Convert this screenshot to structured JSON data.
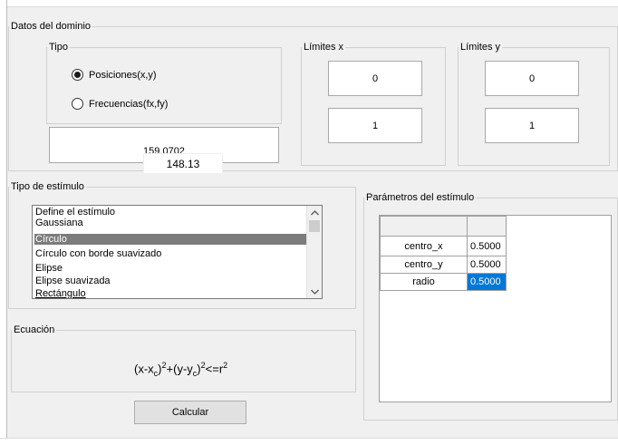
{
  "domain_panel": {
    "title": "Datos del dominio",
    "tipo": {
      "title": "Tipo",
      "options": [
        "Posiciones(x,y)",
        "Frecuencias(fx,fy)"
      ],
      "selected_index": 0
    },
    "value_display": "159.0702",
    "limits_x": {
      "title": "Límites x",
      "min": "0",
      "max": "1"
    },
    "limits_y": {
      "title": "Límites y",
      "min": "0",
      "max": "1"
    }
  },
  "tooltip": "148.13",
  "stimulus_type": {
    "title": "Tipo de estímulo",
    "items": [
      "Define el estímulo",
      "Gaussiana",
      "Círculo",
      "Círculo con borde suavizado",
      "Elipse",
      "Elipse suavizada",
      "Rectángulo"
    ],
    "selected_index": 2
  },
  "equation": {
    "title": "Ecuación",
    "text": "(x-xc)2+(y-yc)2<=r2"
  },
  "params": {
    "title": "Parámetros del estímulo",
    "rows": [
      {
        "name": "centro_x",
        "value": "0.5000"
      },
      {
        "name": "centro_y",
        "value": "0.5000"
      },
      {
        "name": "radio",
        "value": "0.5000"
      }
    ],
    "selected_row": 2
  },
  "actions": {
    "calculate_label": "Calcular"
  },
  "icons": {
    "scroll_up": "chevron-up-icon",
    "scroll_down": "chevron-down-icon"
  }
}
